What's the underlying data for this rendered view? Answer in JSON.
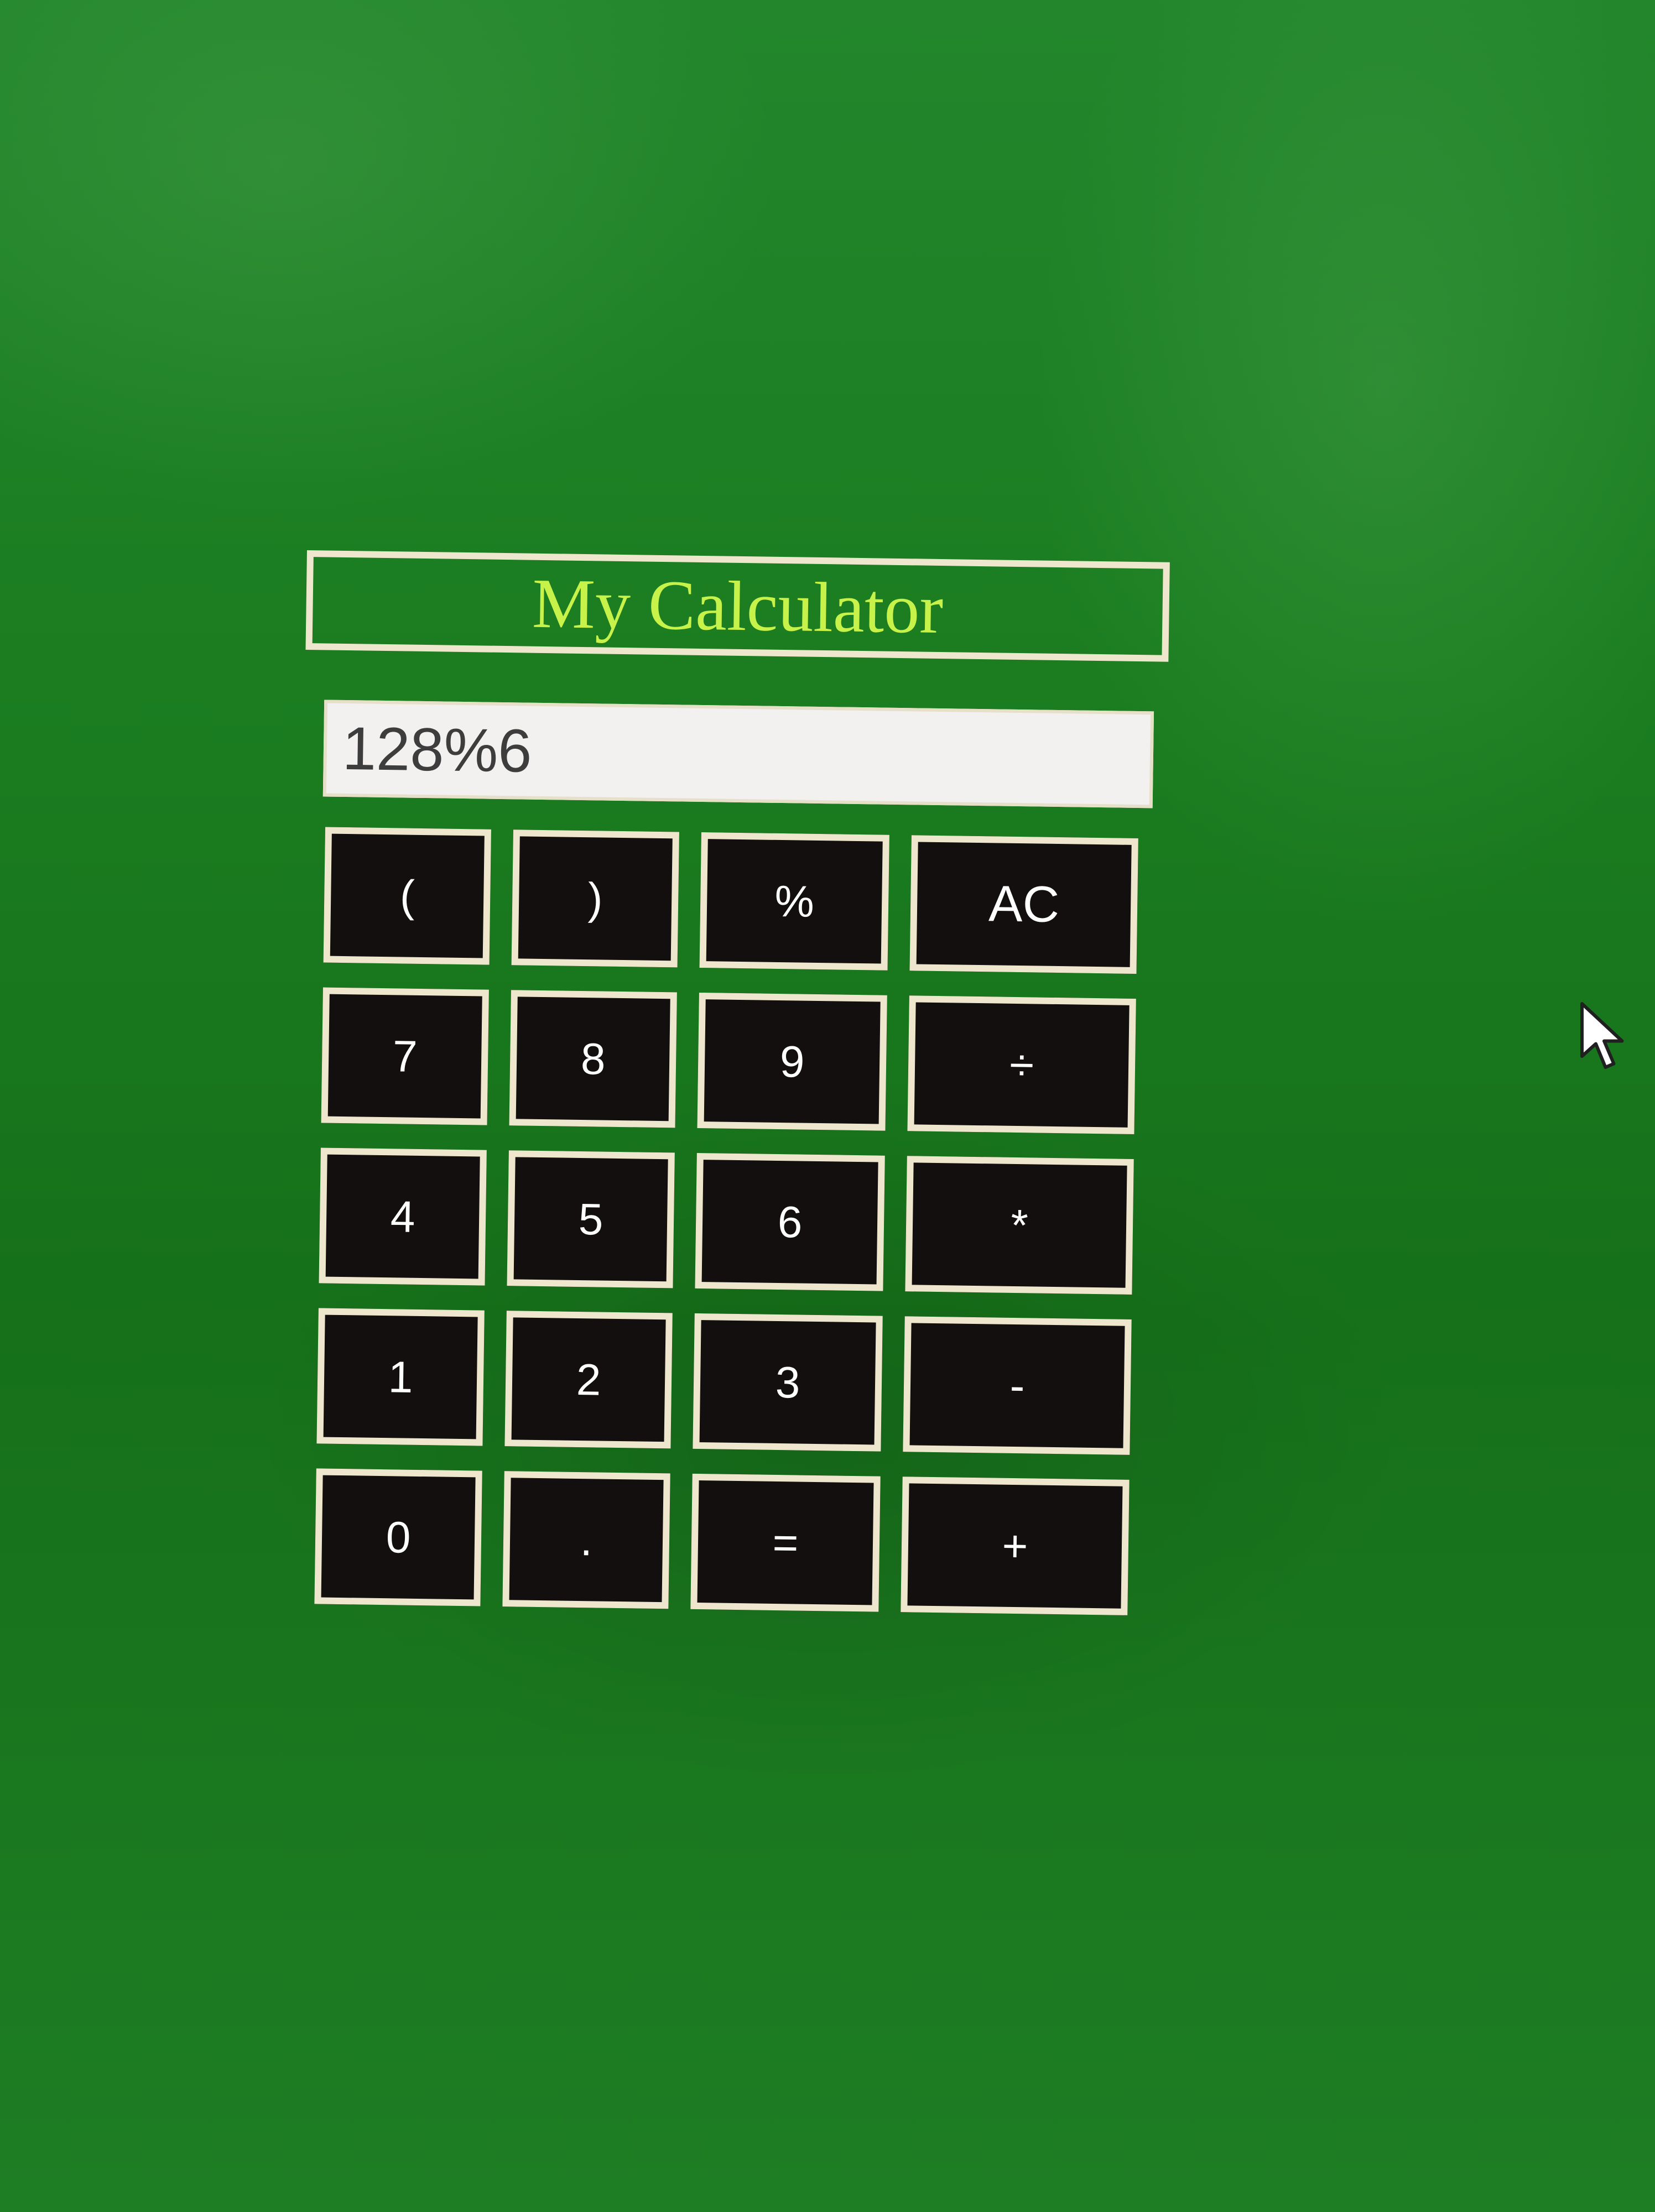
{
  "calculator": {
    "title": "My Calculator",
    "display_value": "128%6",
    "keys": [
      {
        "label": "(",
        "name": "open-paren-button"
      },
      {
        "label": ")",
        "name": "close-paren-button"
      },
      {
        "label": "%",
        "name": "modulo-button"
      },
      {
        "label": "AC",
        "name": "clear-button"
      },
      {
        "label": "7",
        "name": "digit-7-button"
      },
      {
        "label": "8",
        "name": "digit-8-button"
      },
      {
        "label": "9",
        "name": "digit-9-button"
      },
      {
        "label": "÷",
        "name": "divide-button"
      },
      {
        "label": "4",
        "name": "digit-4-button"
      },
      {
        "label": "5",
        "name": "digit-5-button"
      },
      {
        "label": "6",
        "name": "digit-6-button"
      },
      {
        "label": "*",
        "name": "multiply-button"
      },
      {
        "label": "1",
        "name": "digit-1-button"
      },
      {
        "label": "2",
        "name": "digit-2-button"
      },
      {
        "label": "3",
        "name": "digit-3-button"
      },
      {
        "label": "-",
        "name": "subtract-button"
      },
      {
        "label": "0",
        "name": "digit-0-button"
      },
      {
        "label": ".",
        "name": "decimal-button"
      },
      {
        "label": "=",
        "name": "equals-button"
      },
      {
        "label": "+",
        "name": "add-button"
      }
    ]
  },
  "colors": {
    "background": "#1b7d20",
    "title_text": "#c6f24a",
    "frame": "#efe7cd",
    "key_background": "#130f0f",
    "key_text": "#ffffff",
    "display_background": "#f3f0f0"
  },
  "icons": {
    "pointer": "mouse-pointer-icon"
  }
}
